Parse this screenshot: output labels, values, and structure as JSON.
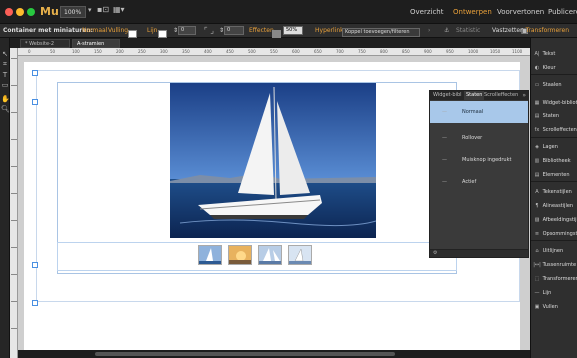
{
  "app": {
    "name": "Mu",
    "zoom": "100%"
  },
  "workspaces": {
    "overzicht": "Overzicht",
    "ontwerpen": "Ontwerpen",
    "voorvertonen": "Voorvertonen",
    "publiceren": "Publiceren"
  },
  "options": {
    "container": "Container met miniaturen:",
    "state": "Normaal",
    "fill_label": "Vulling",
    "stroke_label": "Lijn",
    "stroke_val": "0",
    "corner_val": "0",
    "effects_label": "Effecten",
    "opacity_val": "50%",
    "hyperlinks_label": "Hyperlinks",
    "hyperlink_val": "Koppel toevoegen/filteren",
    "statistic_label": "Statistic",
    "vastzetten_label": "Vastzetten",
    "transform_label": "Transformeren"
  },
  "doc_tabs": {
    "tab1": "* Website-2",
    "tab2": "A-stramien"
  },
  "ruler_marks": [
    "0",
    "50",
    "100",
    "150",
    "200",
    "250",
    "300",
    "350",
    "400",
    "450",
    "500",
    "550",
    "600",
    "650",
    "700",
    "750",
    "800",
    "850",
    "900",
    "950",
    "1000",
    "1050",
    "1100"
  ],
  "panel": {
    "tabs": {
      "widget": "Widget-bibl",
      "staten": "Staten",
      "scroll": "Scrolleffecten"
    },
    "states": [
      "Normaal",
      "Rollover",
      "Muisknop ingedrukt",
      "Actief"
    ]
  },
  "dock": [
    {
      "icon": "A|",
      "label": "Tekst"
    },
    {
      "icon": "◐",
      "label": "Kleur"
    },
    {
      "icon": "▭",
      "label": "Staalen"
    },
    {
      "icon": "▦",
      "label": "Widget-bibliotheek"
    },
    {
      "icon": "▤",
      "label": "Staten"
    },
    {
      "icon": "fx",
      "label": "Scrolleffecten"
    },
    {
      "icon": "◈",
      "label": "Lagen"
    },
    {
      "icon": "▥",
      "label": "Bibliotheek"
    },
    {
      "icon": "▤",
      "label": "Elementen"
    },
    {
      "icon": "A",
      "label": "Tekenstijlen"
    },
    {
      "icon": "¶",
      "label": "Alineastijlen"
    },
    {
      "icon": "▨",
      "label": "Afbeeldingstijlen"
    },
    {
      "icon": "≡",
      "label": "Opsommingstekens"
    },
    {
      "icon": "⌂",
      "label": "Uitlijnen"
    },
    {
      "icon": "|↔|",
      "label": "Tussenruimte"
    },
    {
      "icon": "⬚",
      "label": "Transformeren"
    },
    {
      "icon": "—",
      "label": "Lijn"
    },
    {
      "icon": "▣",
      "label": "Vullen"
    }
  ]
}
